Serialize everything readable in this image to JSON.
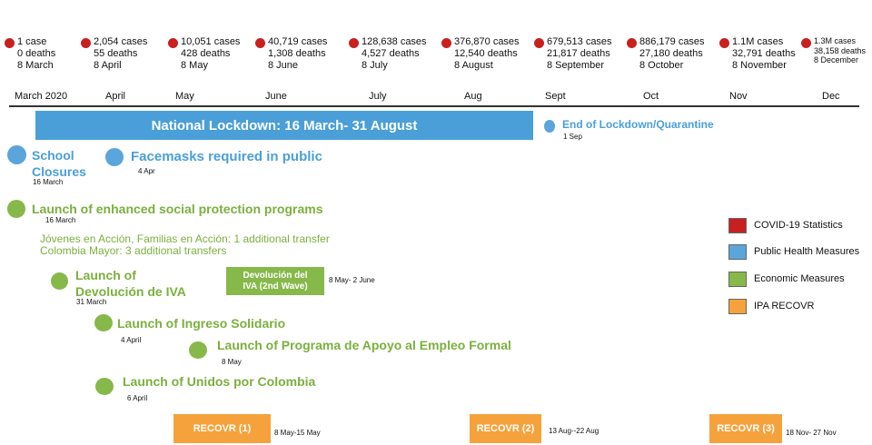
{
  "stats": [
    {
      "cases": "1 case",
      "deaths": "0 deaths",
      "date": "8 March"
    },
    {
      "cases": "2,054 cases",
      "deaths": "55 deaths",
      "date": "8 April"
    },
    {
      "cases": "10,051 cases",
      "deaths": "428 deaths",
      "date": "8 May"
    },
    {
      "cases": "40,719  cases",
      "deaths": "1,308 deaths",
      "date": "8 June"
    },
    {
      "cases": "128,638 cases",
      "deaths": "4,527 deaths",
      "date": "8 July"
    },
    {
      "cases": "376,870 cases",
      "deaths": "12,540 deaths",
      "date": "8 August"
    },
    {
      "cases": "679,513 cases",
      "deaths": "21,817 deaths",
      "date": "8 September"
    },
    {
      "cases": "886,179 cases",
      "deaths": "27,180 deaths",
      "date": "8 October"
    },
    {
      "cases": "1.1M cases",
      "deaths": "32,791 deaths",
      "date": "8 November"
    },
    {
      "cases": "1.3M cases",
      "deaths": "38,158 deaths",
      "date": "8 December"
    }
  ],
  "months": [
    "March 2020",
    "April",
    "May",
    "June",
    "July",
    "Aug",
    "Sept",
    "Oct",
    "Nov",
    "Dec"
  ],
  "lockdown": {
    "label": "National Lockdown: 16 March- 31 August"
  },
  "end_lockdown": {
    "label": "End of Lockdown/Quarantine",
    "date": "1 Sep"
  },
  "school": {
    "line1": "School",
    "line2": "Closures",
    "date": "16 March"
  },
  "facemasks": {
    "label": "Facemasks required in public",
    "date": "4 Apr"
  },
  "social": {
    "label": "Launch of enhanced social protection programs",
    "date": "16 March",
    "detail1": "Jóvenes en Acción, Familias en Acción: 1 additional transfer",
    "detail2": "Colombia Mayor: 3 additional transfers"
  },
  "iva": {
    "line1": "Launch of",
    "line2": "Devolución de IVA",
    "date": "31 March"
  },
  "iva2": {
    "line1": "Devolución del",
    "line2": "IVA (2nd Wave)",
    "date": "8 May- 2 June"
  },
  "ingreso": {
    "label": "Launch of Ingreso Solidario",
    "date": "4 April"
  },
  "empleo": {
    "label": "Launch of Programa de Apoyo al Empleo Formal",
    "date": "8 May"
  },
  "unidos": {
    "label": "Launch of Unidos por Colombia",
    "date": "6 April"
  },
  "recovr": [
    {
      "label": "RECOVR (1)",
      "date": "8 May-15 May"
    },
    {
      "label": "RECOVR (2)",
      "date": "13 Aug--22 Aug"
    },
    {
      "label": "RECOVR (3)",
      "date": "18 Nov- 27 Nov"
    }
  ],
  "legend": [
    {
      "label": "COVID-19 Statistics",
      "color": "#c8201e"
    },
    {
      "label": "Public Health Measures",
      "color": "#5aa5dc"
    },
    {
      "label": "Economic Measures",
      "color": "#86b84a"
    },
    {
      "label": "IPA RECOVR",
      "color": "#f5a23c"
    }
  ]
}
